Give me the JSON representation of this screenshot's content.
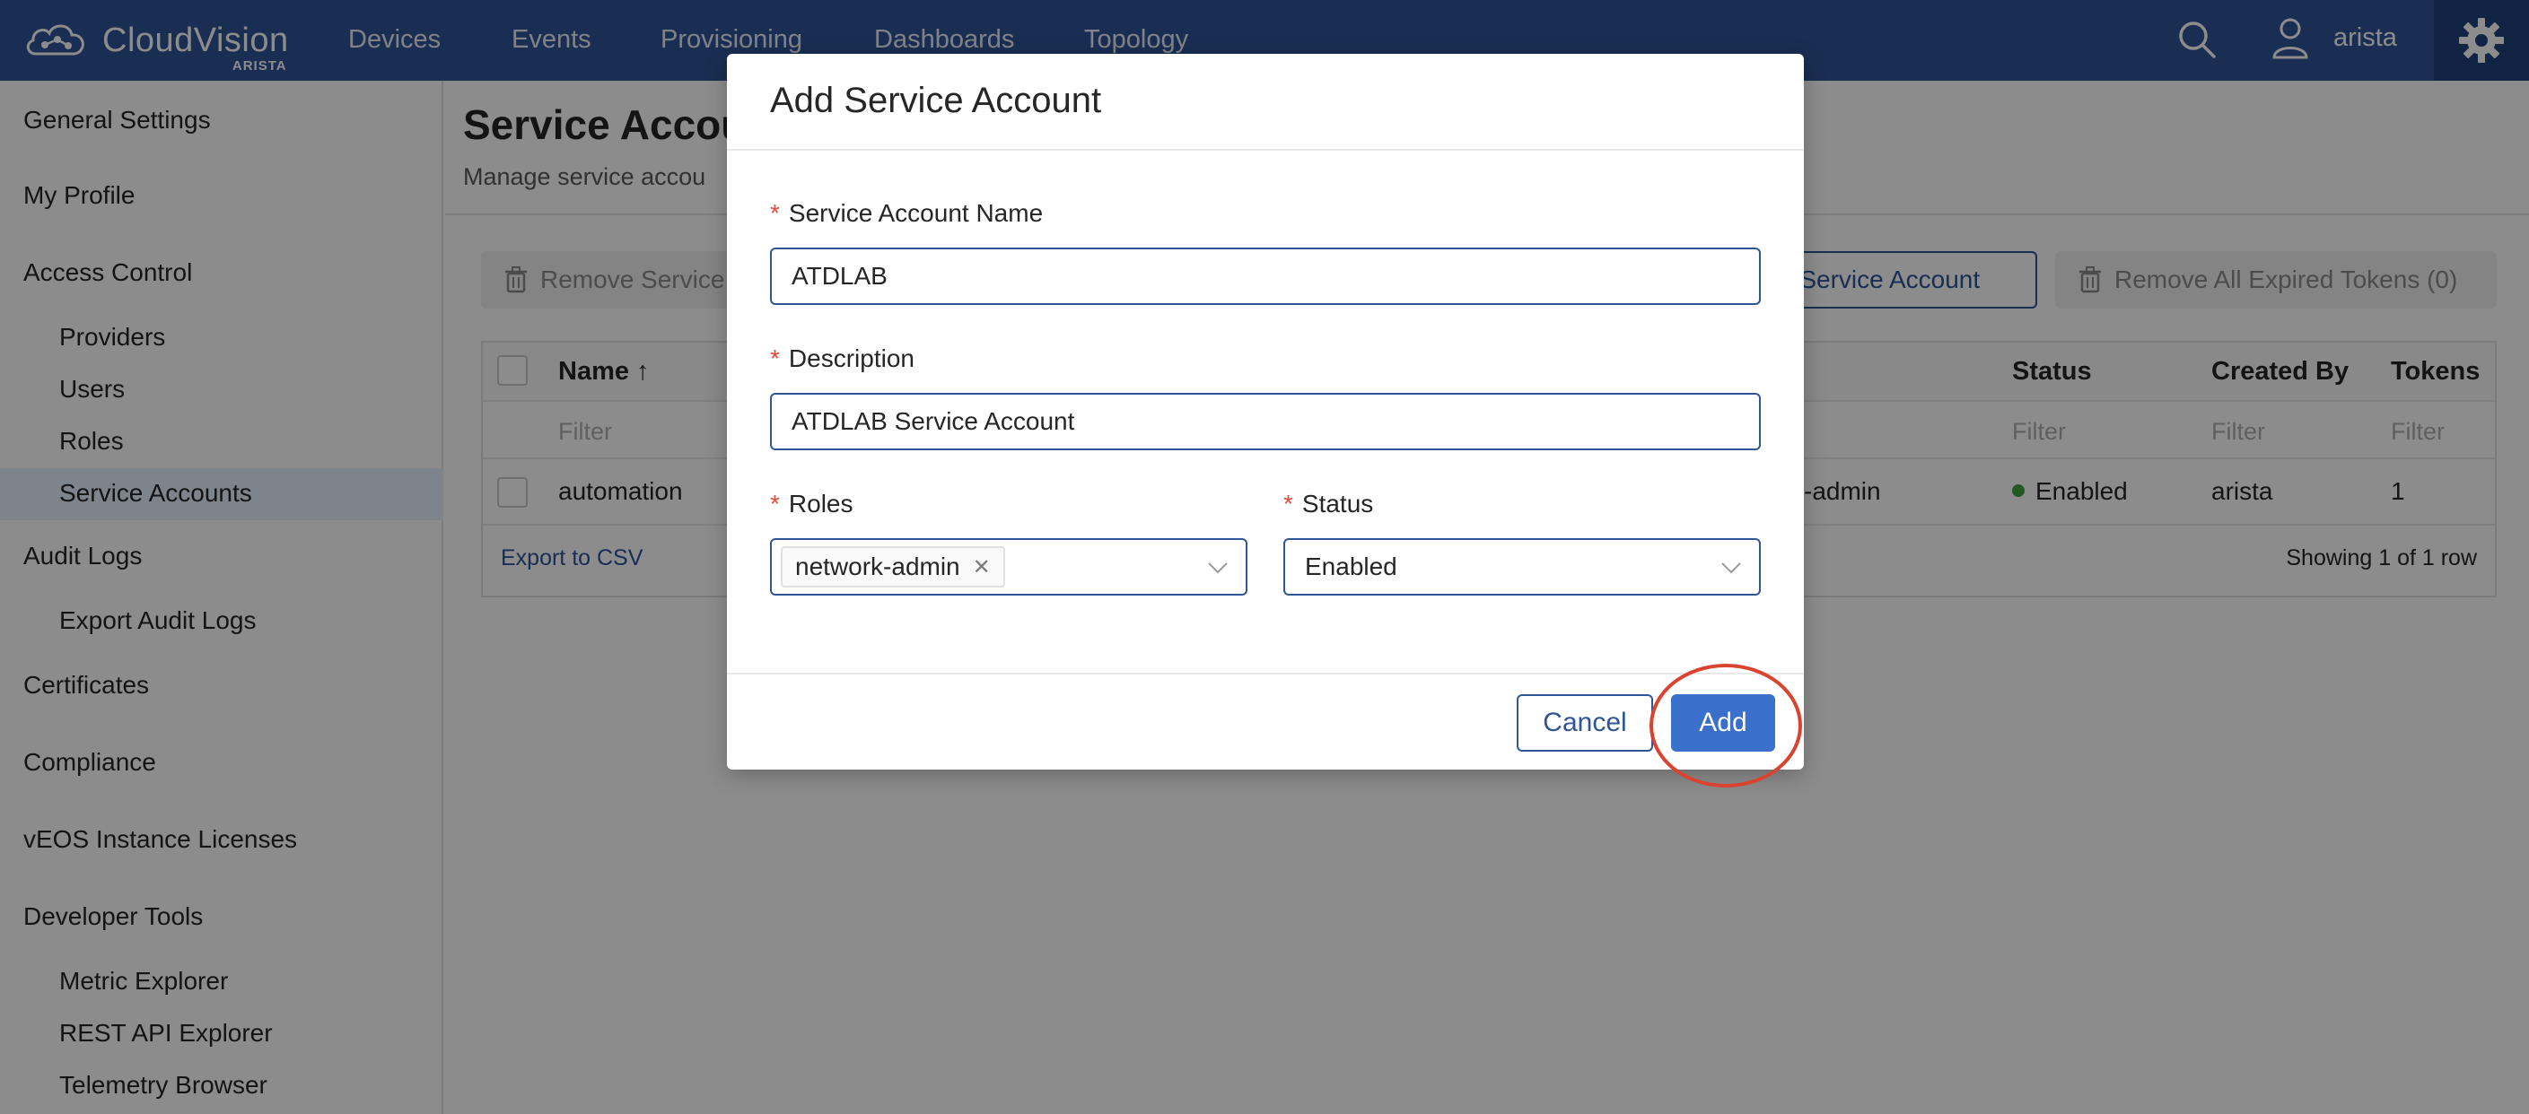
{
  "nav": {
    "brand": "CloudVision",
    "brand_sub": "ARISTA",
    "items": [
      "Devices",
      "Events",
      "Provisioning",
      "Dashboards",
      "Topology"
    ],
    "username": "arista",
    "icons": [
      "cloud-logo-icon",
      "search-icon",
      "user-icon",
      "gear-icon"
    ]
  },
  "sidebar": {
    "general_settings": "General Settings",
    "my_profile": "My Profile",
    "access_control": "Access Control",
    "providers": "Providers",
    "users": "Users",
    "roles": "Roles",
    "service_accounts": "Service Accounts",
    "audit_logs": "Audit Logs",
    "export_audit_logs": "Export Audit Logs",
    "certificates": "Certificates",
    "compliance": "Compliance",
    "veos_licenses": "vEOS Instance Licenses",
    "developer_tools": "Developer Tools",
    "metric_explorer": "Metric Explorer",
    "rest_api_explorer": "REST API Explorer",
    "telemetry_browser": "Telemetry Browser",
    "active": "Service Accounts"
  },
  "page": {
    "title": "Service Accou",
    "subtitle": "Manage service accou",
    "remove_button": "Remove Service",
    "add_button": "d Service Account",
    "remove_expired_button": "Remove All Expired Tokens (0)"
  },
  "table": {
    "headers": {
      "name": "Name ↑",
      "status": "Status",
      "created_by": "Created By",
      "tokens": "Tokens"
    },
    "filter_placeholder": "Filter",
    "rows": [
      {
        "name": "automation",
        "roles": "k-admin",
        "status": "Enabled",
        "created_by": "arista",
        "tokens": "1"
      }
    ],
    "export": "Export to CSV",
    "showing": "Showing 1 of 1 row"
  },
  "modal": {
    "title": "Add Service Account",
    "name_label": "Service Account Name",
    "name_value": "ATDLAB",
    "description_label": "Description",
    "description_value": "ATDLAB Service Account",
    "roles_label": "Roles",
    "roles_tag": "network-admin",
    "status_label": "Status",
    "status_value": "Enabled",
    "required_mark": "*",
    "cancel": "Cancel",
    "add": "Add"
  },
  "colors": {
    "nav_bg": "#2f5596",
    "accent": "#3b6fcc",
    "required": "#e8483c",
    "highlight": "#d9432f",
    "status_enabled": "#3ca33c"
  }
}
